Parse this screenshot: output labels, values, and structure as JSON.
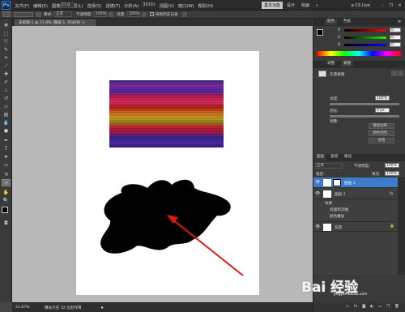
{
  "app": {
    "logo": "Ps"
  },
  "menubar": {
    "items": [
      "文件(F)",
      "编辑(E)",
      "图像(I)",
      "图层(L)",
      "选择(S)",
      "滤镜(T)",
      "分析(A)",
      "3D(D)",
      "视图(V)",
      "窗口(W)",
      "帮助(H)"
    ],
    "zoom": "21.8",
    "workspaces": {
      "basic": "基本功能",
      "design": "设计",
      "painting": "绘画"
    },
    "cs_live": "CS Live"
  },
  "optionbar": {
    "mode_label": "模式:",
    "mode_value": "正常",
    "opacity_label": "不透明度:",
    "opacity_value": "100%",
    "flow_label": "流量:",
    "flow_value": "100%",
    "erase_label": "抹到历史记录"
  },
  "document": {
    "tab_title": "未标题-1 @ 21.8% (图层 1, RGB/8) ×"
  },
  "statusbar": {
    "zoom": "21.87%",
    "info": "曝光只在 32 位起作用"
  },
  "panels": {
    "color_tab": "颜色",
    "swatches_tab": "色板",
    "color_sliders": [
      {
        "label": "R",
        "value": "0"
      },
      {
        "label": "G",
        "value": "0"
      },
      {
        "label": "B",
        "value": "0"
      }
    ],
    "adjust_tab": "调整",
    "masks_tab": "蒙版",
    "mask_title": "矢量蒙版",
    "density_label": "浓度:",
    "density_value": "100%",
    "feather_label": "羽化:",
    "feather_value": "0 px",
    "refine_label": "调整:",
    "mask_edge_btn": "蒙版边缘...",
    "color_range_btn": "颜色范围...",
    "invert_btn": "反相",
    "layers_tab": "图层",
    "channels_tab": "通道",
    "paths_tab": "路径",
    "blend_mode": "正常",
    "opacity_label": "不透明度:",
    "opacity_value": "100%",
    "lock_label": "锁定:",
    "fill_label": "填充:",
    "fill_value": "100%",
    "layers": [
      {
        "name": "图层 1"
      },
      {
        "name": "图层 2"
      },
      {
        "name": "效果"
      },
      {
        "name": "斜面和浮雕"
      },
      {
        "name": "颜色叠加"
      },
      {
        "name": "背景"
      }
    ]
  },
  "watermark": "Bai 经验",
  "watermark_url": "jingyan.baidu.com"
}
